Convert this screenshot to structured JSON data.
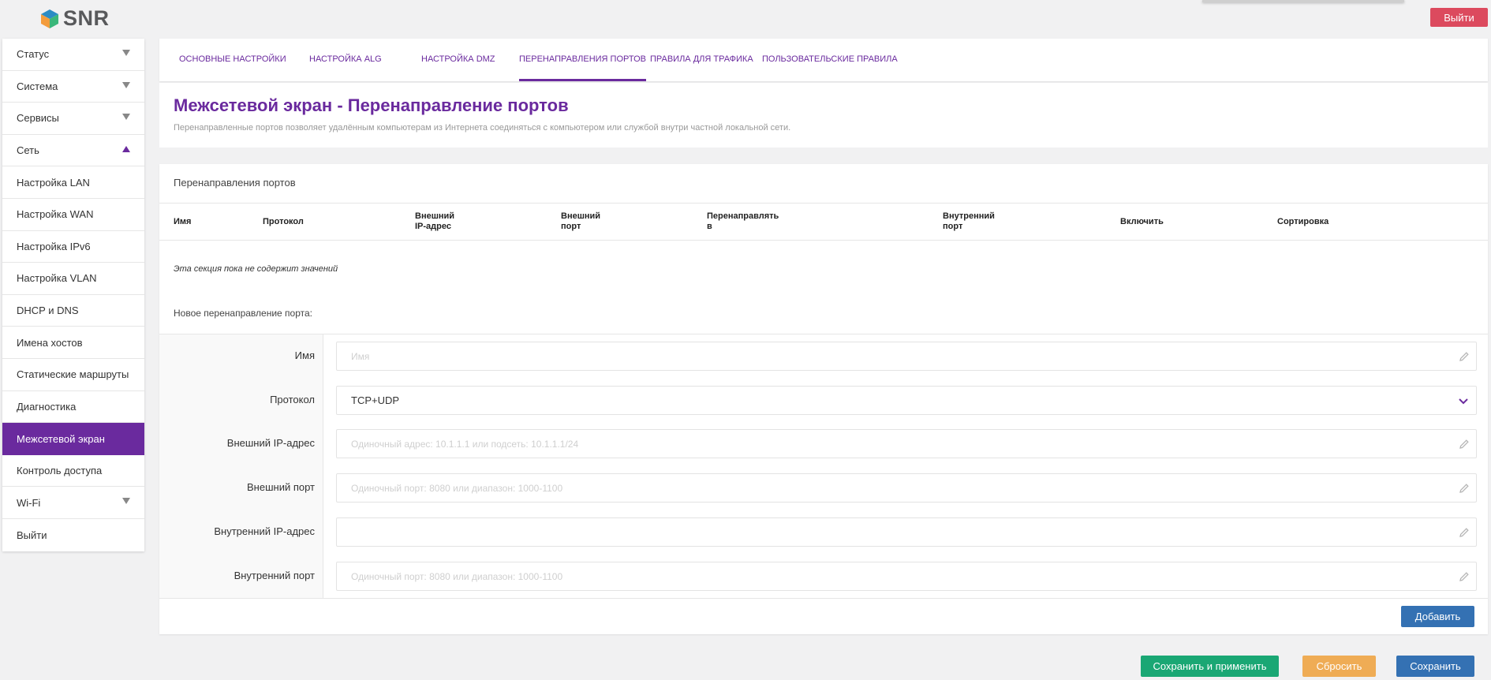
{
  "brand": {
    "name": "SNR",
    "colors": {
      "accent": "#6a2a9e",
      "danger": "#dc4a5e",
      "success": "#1aa774",
      "warning": "#efac55",
      "primary": "#3471b3"
    }
  },
  "header": {
    "logout_label": "Выйти"
  },
  "sidebar": {
    "items": [
      {
        "label": "Статус",
        "arrow": "down"
      },
      {
        "label": "Система",
        "arrow": "down"
      },
      {
        "label": "Сервисы",
        "arrow": "down"
      },
      {
        "label": "Сеть",
        "arrow": "up"
      },
      {
        "label": "Настройка LAN"
      },
      {
        "label": "Настройка WAN"
      },
      {
        "label": "Настройка IPv6"
      },
      {
        "label": "Настройка VLAN"
      },
      {
        "label": "DHCP и DNS"
      },
      {
        "label": "Имена хостов"
      },
      {
        "label": "Статические маршруты"
      },
      {
        "label": "Диагностика"
      },
      {
        "label": "Межсетевой экран",
        "active": true
      },
      {
        "label": "Контроль доступа"
      },
      {
        "label": "Wi-Fi",
        "arrow": "down"
      },
      {
        "label": "Выйти"
      }
    ]
  },
  "tabs": [
    {
      "label": "ОСНОВНЫЕ НАСТРОЙКИ"
    },
    {
      "label": "НАСТРОЙКА ALG"
    },
    {
      "label": "НАСТРОЙКА DMZ"
    },
    {
      "label": "ПЕРЕНАПРАВЛЕНИЯ ПОРТОВ",
      "active": true
    },
    {
      "label": "ПРАВИЛА ДЛЯ ТРАФИКА"
    },
    {
      "label": "ПОЛЬЗОВАТЕЛЬСКИЕ ПРАВИЛА"
    }
  ],
  "page": {
    "title": "Межсетевой экран - Перенаправление портов",
    "description": "Перенаправленные портов позволяет удалённым компьютерам из Интернета соединяться с компьютером или службой внутри частной локальной сети."
  },
  "table": {
    "section_title": "Перенаправления портов",
    "columns": [
      "Имя",
      "Протокол",
      "Внешний\nIP-адрес",
      "Внешний\nпорт",
      "Перенаправлять\nв",
      "Внутренний\nпорт",
      "Включить",
      "Сортировка"
    ],
    "empty_text": "Эта секция пока не содержит значений"
  },
  "new_rule": {
    "title": "Новое перенаправление порта:",
    "fields": {
      "name": {
        "label": "Имя",
        "placeholder": "Имя",
        "value": ""
      },
      "protocol": {
        "label": "Протокол",
        "value": "TCP+UDP"
      },
      "ext_ip": {
        "label": "Внешний IP-адрес",
        "placeholder": "Одиночный адрес: 10.1.1.1 или подсеть: 10.1.1.1/24",
        "value": ""
      },
      "ext_port": {
        "label": "Внешний порт",
        "placeholder": "Одиночный порт: 8080 или диапазон: 1000-1100",
        "value": ""
      },
      "int_ip": {
        "label": "Внутренний IP-адрес",
        "placeholder": "",
        "value": ""
      },
      "int_port": {
        "label": "Внутренний порт",
        "placeholder": "Одиночный порт: 8080 или диапазон: 1000-1100",
        "value": ""
      }
    },
    "add_label": "Добавить"
  },
  "footer": {
    "save_apply_label": "Сохранить и применить",
    "reset_label": "Сбросить",
    "save_label": "Сохранить"
  }
}
